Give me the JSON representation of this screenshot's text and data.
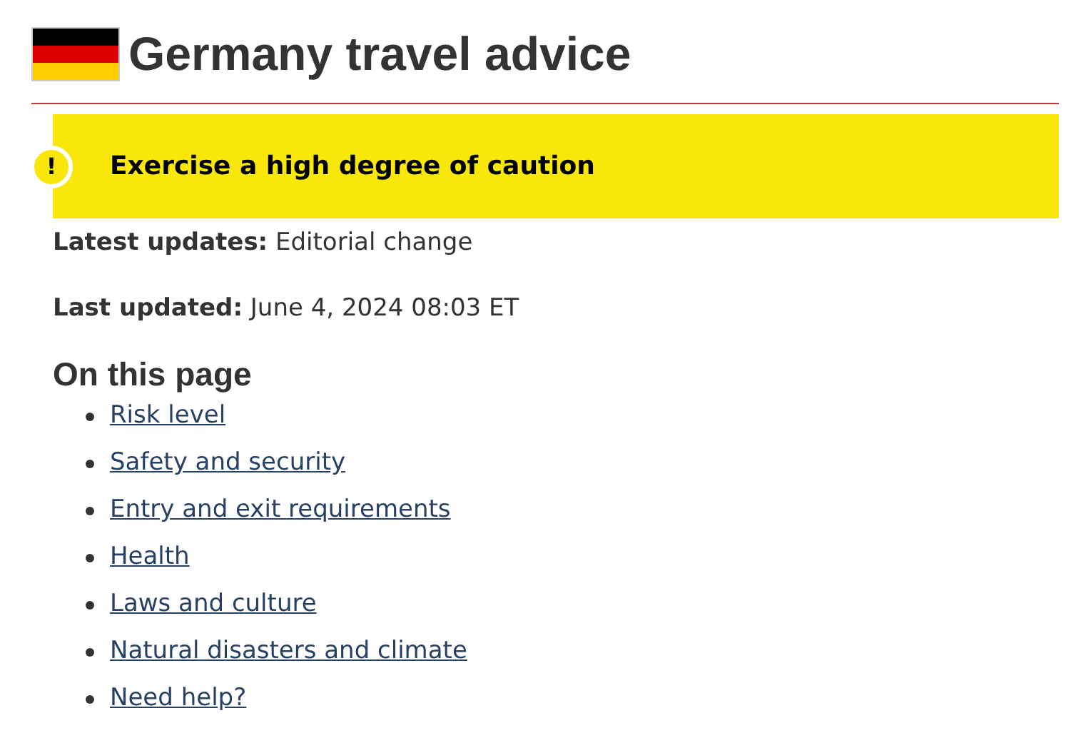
{
  "title": "Germany travel advice",
  "risk_banner": {
    "icon": "!",
    "text": "Exercise a high degree of caution"
  },
  "updates": [
    "**Latest updates:** Editorial change",
    "**Last updated:** June 4, 2024 08:03 ET"
  ],
  "on_this_page": {
    "heading": "On this page",
    "links": [
      "Risk level",
      "Safety and security",
      "Entry and exit requirements",
      "Health",
      "Laws and culture",
      "Natural disasters and climate",
      "Need help?"
    ]
  }
}
